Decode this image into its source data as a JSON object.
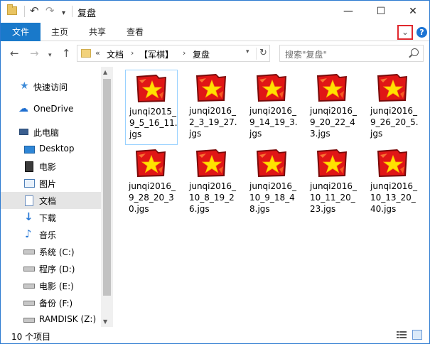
{
  "window": {
    "title": "复盘",
    "minimize": "—",
    "maximize": "☐",
    "close": "✕"
  },
  "ribbon": {
    "file_tab": "文件",
    "tabs": [
      "主页",
      "共享",
      "查看"
    ],
    "expand_icon": "chevron-down-icon",
    "help": "?"
  },
  "address": {
    "prefix": "«",
    "parts": [
      "文档",
      "【军棋】",
      "复盘"
    ],
    "search_placeholder": "搜索\"复盘\""
  },
  "nav": {
    "quick_access": "快速访问",
    "onedrive": "OneDrive",
    "this_pc": "此电脑",
    "items": [
      {
        "label": "Desktop",
        "icon": "desktop-icon"
      },
      {
        "label": "电影",
        "icon": "video-icon"
      },
      {
        "label": "图片",
        "icon": "pictures-icon"
      },
      {
        "label": "文档",
        "icon": "documents-icon"
      },
      {
        "label": "下载",
        "icon": "download-icon"
      },
      {
        "label": "音乐",
        "icon": "music-icon"
      },
      {
        "label": "系统 (C:)",
        "icon": "system-drive-icon"
      },
      {
        "label": "程序 (D:)",
        "icon": "drive-icon"
      },
      {
        "label": "电影 (E:)",
        "icon": "drive-icon"
      },
      {
        "label": "备份 (F:)",
        "icon": "drive-icon"
      },
      {
        "label": "RAMDISK (Z:)",
        "icon": "drive-icon"
      }
    ]
  },
  "files": [
    "junqi2015_9_5_16_11.jgs",
    "junqi2016_2_3_19_27.jgs",
    "junqi2016_9_14_19_3.jgs",
    "junqi2016_9_20_22_43.jgs",
    "junqi2016_9_26_20_5.jgs",
    "junqi2016_9_28_20_30.jgs",
    "junqi2016_10_8_19_26.jgs",
    "junqi2016_10_9_18_48.jgs",
    "junqi2016_10_11_20_23.jgs",
    "junqi2016_10_13_20_40.jgs"
  ],
  "status": {
    "count": "10 个项目"
  },
  "colors": {
    "accent": "#1979ca",
    "selected": "#cce8ff",
    "highlight_box": "#e0282e"
  }
}
